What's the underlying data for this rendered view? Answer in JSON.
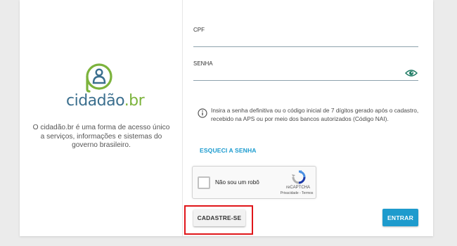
{
  "brand": {
    "logo_name": "cidadão",
    "logo_suffix": ".br",
    "tagline": "O cidadão.br é uma forma de acesso único a serviços, informações e sistemas do governo brasileiro.",
    "colors": {
      "primary": "#3b6f8e",
      "accent": "#7cb33c"
    }
  },
  "form": {
    "cpf_label": "CPF",
    "cpf_value": "",
    "senha_label": "SENHA",
    "senha_value": "",
    "info_text": "Insira a senha definitiva ou o código inicial de 7 dígitos gerado após o cadastro, recebido na APS ou por meio dos bancos autorizados (Código NAI).",
    "forgot_label": "ESQUECI A SENHA",
    "show_password_icon": "eye-icon",
    "info_icon": "info-icon"
  },
  "captcha": {
    "label": "Não sou um robô",
    "brand": "reCAPTCHA",
    "links": "Privacidade - Termos",
    "checked": false
  },
  "actions": {
    "cadastre_label": "CADASTRE-SE",
    "entrar_label": "ENTRAR",
    "entrar_color": "#1e9bcd",
    "highlight_color": "#e0161a"
  }
}
